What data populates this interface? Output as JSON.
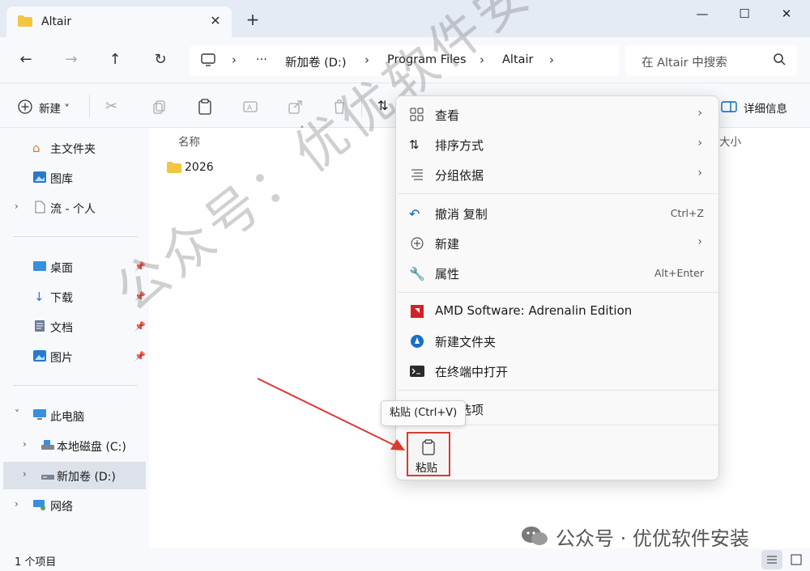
{
  "window": {
    "tab_title": "Altair",
    "tab_close": "✕",
    "new_tab": "+",
    "minimize": "—",
    "maximize": "☐",
    "close": "✕"
  },
  "address": {
    "more": "···",
    "crumbs": [
      "新加卷 (D:)",
      "Program Files",
      "Altair"
    ],
    "search_placeholder": "在 Altair 中搜索"
  },
  "toolbar": {
    "new_label": "新建",
    "details_label": "详细信息"
  },
  "sidebar": {
    "items": [
      {
        "label": "主文件夹",
        "icon": "home-icon"
      },
      {
        "label": "图库",
        "icon": "gallery-icon"
      },
      {
        "label": "流 - 个人",
        "icon": "document-icon"
      },
      {
        "label": "桌面",
        "icon": "desktop-icon"
      },
      {
        "label": "下载",
        "icon": "download-icon"
      },
      {
        "label": "文档",
        "icon": "documents-icon"
      },
      {
        "label": "图片",
        "icon": "pictures-icon"
      },
      {
        "label": "此电脑",
        "icon": "computer-icon"
      },
      {
        "label": "本地磁盘 (C:)",
        "icon": "drive-icon"
      },
      {
        "label": "新加卷 (D:)",
        "icon": "drive-icon"
      },
      {
        "label": "网络",
        "icon": "network-icon"
      }
    ]
  },
  "content": {
    "col_name": "名称",
    "col_size": "大小",
    "items": [
      {
        "name": "2026",
        "icon": "folder-icon"
      }
    ]
  },
  "status": {
    "count": "1 个项目"
  },
  "context_menu": {
    "items": [
      {
        "label": "查看",
        "shortcut": "",
        "submenu": true
      },
      {
        "label": "排序方式",
        "shortcut": "",
        "submenu": true
      },
      {
        "label": "分组依据",
        "shortcut": "",
        "submenu": true
      },
      {
        "label": "撤消 复制",
        "shortcut": "Ctrl+Z",
        "submenu": false
      },
      {
        "label": "新建",
        "shortcut": "",
        "submenu": true
      },
      {
        "label": "属性",
        "shortcut": "Alt+Enter",
        "submenu": false
      },
      {
        "label": "AMD Software: Adrenalin Edition",
        "shortcut": "",
        "submenu": false
      },
      {
        "label": "新建文件夹",
        "shortcut": "",
        "submenu": false
      },
      {
        "label": "在终端中打开",
        "shortcut": "",
        "submenu": false
      },
      {
        "label": "更多选项",
        "shortcut": "",
        "submenu": false
      }
    ],
    "tooltip": "粘贴 (Ctrl+V)",
    "paste_label": "粘贴"
  },
  "watermark": {
    "diagonal": "公众号：优优软件安装",
    "footer": "公众号 · 优优软件安装"
  },
  "colors": {
    "accent": "#0067c0",
    "highlight": "#d93a32"
  }
}
